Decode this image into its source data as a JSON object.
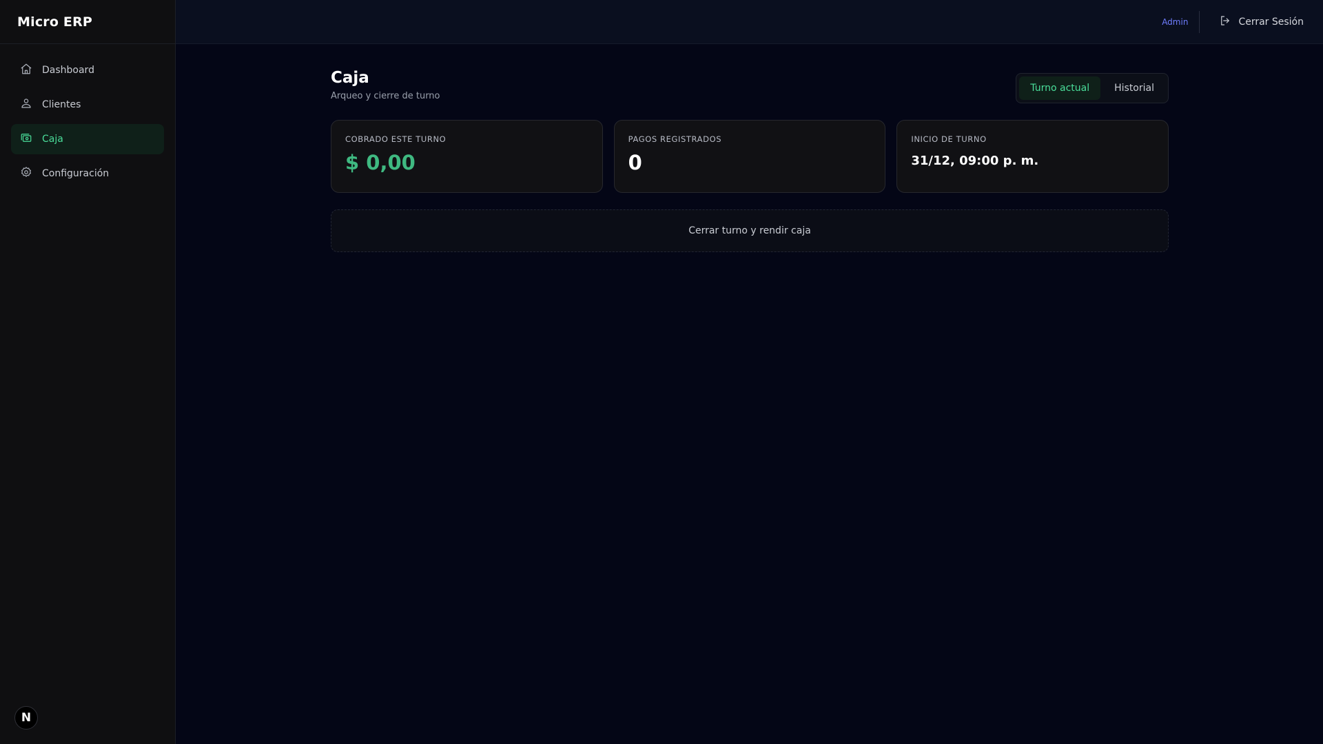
{
  "app": {
    "brand": "Micro ERP",
    "badge_letter": "N"
  },
  "sidebar": {
    "items": [
      {
        "label": "Dashboard",
        "icon": "home-icon",
        "active": false
      },
      {
        "label": "Clientes",
        "icon": "users-icon",
        "active": false
      },
      {
        "label": "Caja",
        "icon": "cash-register-icon",
        "active": true
      },
      {
        "label": "Configuración",
        "icon": "gear-icon",
        "active": false
      }
    ]
  },
  "topbar": {
    "admin_label": "Admin",
    "logout_label": "Cerrar Sesión"
  },
  "page": {
    "title": "Caja",
    "subtitle": "Arqueo y cierre de turno",
    "tabs": [
      {
        "label": "Turno actual",
        "active": true
      },
      {
        "label": "Historial",
        "active": false
      }
    ]
  },
  "cards": [
    {
      "label": "Cobrado este turno",
      "value": "$ 0,00"
    },
    {
      "label": "Pagos registrados",
      "value": "0"
    },
    {
      "label": "Inicio de turno",
      "value": "31/12, 09:00 p. m."
    }
  ],
  "actions": {
    "close_shift_label": "Cerrar turno y rendir caja"
  },
  "colors": {
    "accent": "#3fb981",
    "accent_bg": "#0f2019",
    "link": "#6f7dff",
    "background": "#040616",
    "sidebar_bg": "#0f0f11"
  }
}
